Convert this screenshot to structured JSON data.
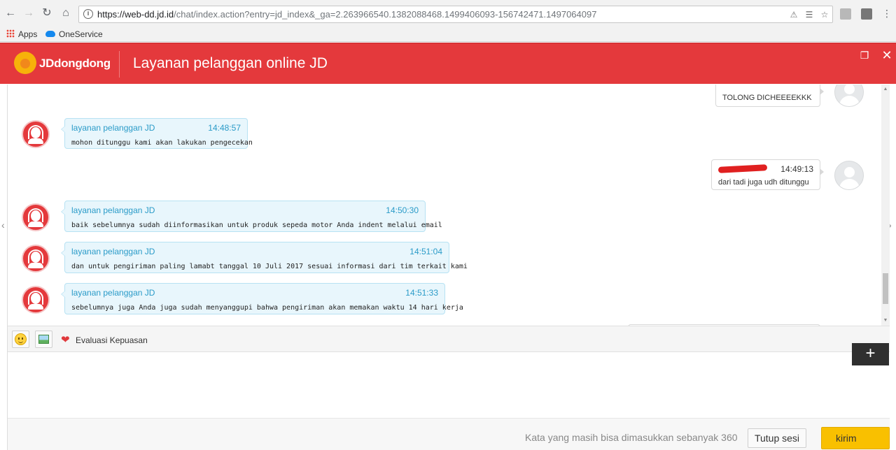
{
  "browser": {
    "url_host": "https://web-dd.jd.id",
    "url_path": "/chat/index.action?entry=jd_index&_ga=2.263966540.1382088468.1499406093-156742471.1497064097",
    "bookmarks": [
      {
        "label": "Apps"
      },
      {
        "label": "OneService"
      }
    ]
  },
  "header": {
    "logo_text": "JDdongdong",
    "title": "Layanan pelanggan online JD"
  },
  "messages": [
    {
      "role": "user",
      "sender": "",
      "time": "",
      "text": "TOLONG DICHEEEEKKK"
    },
    {
      "role": "agent",
      "sender": "layanan pelanggan JD",
      "time": "14:48:57",
      "text": "mohon ditunggu kami akan lakukan pengecekan"
    },
    {
      "role": "user",
      "sender": "",
      "time": "14:49:13",
      "text": "dari tadi juga udh ditunggu"
    },
    {
      "role": "agent",
      "sender": "layanan pelanggan JD",
      "time": "14:50:30",
      "text": "baik sebelumnya sudah diinformasikan untuk produk sepeda motor Anda indent melalui email"
    },
    {
      "role": "agent",
      "sender": "layanan pelanggan JD",
      "time": "14:51:04",
      "text": "dan untuk pengiriman paling lamabt tanggal 10 Juli 2017 sesuai informasi dari tim terkait kami"
    },
    {
      "role": "agent",
      "sender": "layanan pelanggan JD",
      "time": "14:51:33",
      "text": "sebelumnya juga Anda juga sudah menyanggupi bahwa pengiriman akan memakan waktu 14 hari kerja"
    }
  ],
  "toolbar": {
    "evaluation_label": "Evaluasi Kepuasan"
  },
  "footer": {
    "counter_text": "Kata yang masih bisa dimasukkan sebanyak 360",
    "close_session_label": "Tutup sesi",
    "send_label": "kirim",
    "plus_label": "+"
  },
  "colors": {
    "brand_red": "#e4393c",
    "agent_name": "#2a9bc8",
    "send_yellow": "#f9c000"
  }
}
